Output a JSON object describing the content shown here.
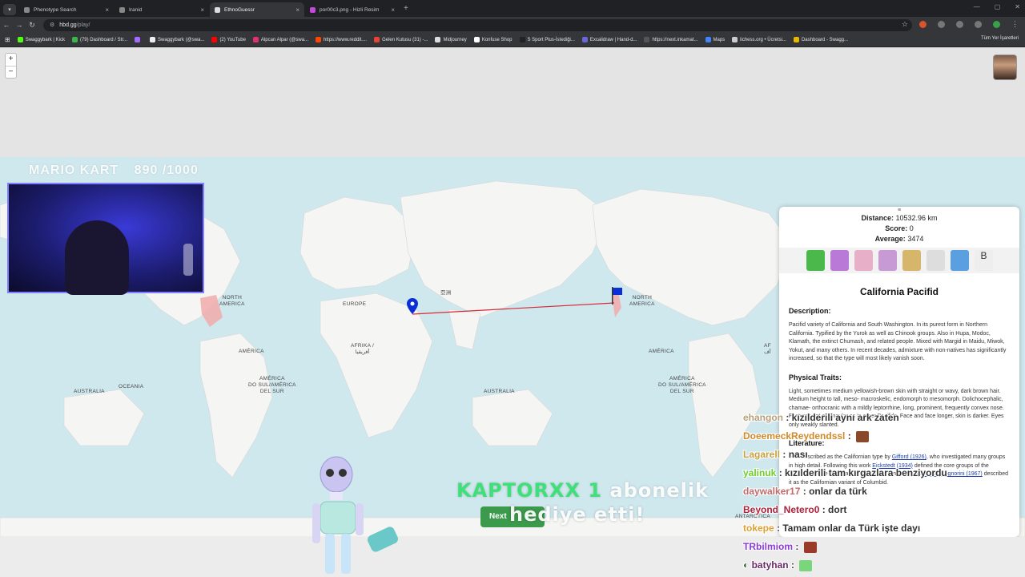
{
  "browser": {
    "tabs": [
      {
        "label": "Phenotype Search",
        "active": false
      },
      {
        "label": "Iranid",
        "active": false
      },
      {
        "label": "EthnoGuessr",
        "active": true
      },
      {
        "label": "por00c3.png - Hizli Resim",
        "active": false
      }
    ],
    "new_tab": "+",
    "url_host": "hbd.gg",
    "url_path": "/play/",
    "bookmarks": [
      {
        "label": "Swaggybark | Kick",
        "color": "#53fc18"
      },
      {
        "label": "(79) Dashboard / Str...",
        "color": "#39b54a"
      },
      {
        "label": "",
        "color": "#a36bff"
      },
      {
        "label": "Swaggybark (@swa...",
        "color": "#eeeeee"
      },
      {
        "label": "(2) YouTube",
        "color": "#ff0000"
      },
      {
        "label": "Alpcan Alpar (@swa...",
        "color": "#e1306c"
      },
      {
        "label": "https://www.reddit....",
        "color": "#ff4500"
      },
      {
        "label": "Gelen Kutusu (31) -...",
        "color": "#ea4335"
      },
      {
        "label": "Midjourney",
        "color": "#dddddd"
      },
      {
        "label": "Konfuse Shop",
        "color": "#ffffff"
      },
      {
        "label": "S Sport Plus-İstediği...",
        "color": "#222222"
      },
      {
        "label": "Excalidraw | Hand-d...",
        "color": "#6965db"
      },
      {
        "label": "https://next.inkamat...",
        "color": "#555555"
      },
      {
        "label": "Maps",
        "color": "#4285f4"
      },
      {
        "label": "lichess.org • Ücretsi...",
        "color": "#cccccc"
      },
      {
        "label": "Dashboard - Swagg...",
        "color": "#e6b800"
      }
    ],
    "bookmarks_all": "Tüm Yer İşaretleri"
  },
  "map": {
    "zoom_in": "+",
    "zoom_out": "−",
    "labels": {
      "na1": "NORTH\nAMERICA",
      "sa1": "AMÉRICA",
      "europe": "EUROPE",
      "africa": "AFRIKA /\nأفريقيا",
      "asia_jp": "亞洲",
      "australia1": "AUSTRALIA",
      "oceania": "OCEANIA",
      "sa2": "AMÉRICA\nDO SUL/AMÉRICA\nDEL SUR",
      "australia2": "AUSTRALIA",
      "na2": "NORTH\nAMERICA",
      "sa3": "AMÉRICA",
      "sa4": "AMÉRICA\nDO SUL/AMÉRICA\nDEL SUR",
      "antarctica": "ANTARCTICA",
      "africa2": "AF\nأف"
    },
    "guess_color": "#0a2fd6",
    "answer_flag_color": "#0a2fd6",
    "line_color": "#d62b3a"
  },
  "stream_overlay": {
    "title": "MARIO KART",
    "progress": "890 /1000"
  },
  "result": {
    "handle": "≡",
    "distance_label": "Distance:",
    "distance_value": "10532.96 km",
    "score_label": "Score:",
    "score_value": "0",
    "average_label": "Average:",
    "average_value": "3474",
    "name": "California Pacifid",
    "description_heading": "Description:",
    "description": "Pacifid variety of California and South Washington. In its purest form in Northern California. Typified by the Yurok as well as Chinook groups. Also in Hupa, Modoc, Klamath, the extinct Chumash, and related people. Mixed with Margid in Maidu, Miwok, Yokut, and many others. In recent decades, admixture with non-natives has significantly increased, so that the type will most likely vanish soon.",
    "traits_heading": "Physical Traits:",
    "traits": "Light, sometimes medium yellowish-brown skin with straight or wavy, dark brown hair. Medium height to tall, meso- macroskelic, endomorph to mesomorph. Dolichocephalic, chamae- orthocranic with a mildly leptorrhine, long, prominent, frequently convex nose. Features not as angular as in other Pacifids. Face and face longer, skin is darker. Eyes only weakly slanted.",
    "literature_heading": "Literature:",
    "literature_a": "First described as the Californian type by ",
    "literature_link1": "Gifford (1926)",
    "literature_b": ", who investigated many groups in high detail. Following this work ",
    "literature_link2": "Eickstedt (1934)",
    "literature_c": " defined the core groups of the Californian type as a Pacifid subvariety. Similarly, ",
    "literature_link3": "Biasutti and Signorini (1967)",
    "literature_d": " described it as the Californian variant of Columbid."
  },
  "chat": [
    {
      "user": "ehangon",
      "sep": " : ",
      "msg": "kızılderili aynı ark zaten",
      "color": "#b8a07a"
    },
    {
      "user": "DoeemeckReydendssl",
      "sep": " : ",
      "msg": "",
      "color": "#d08a2a",
      "emote": "#8a4a2a"
    },
    {
      "user": "Lagarell",
      "sep": " : ",
      "msg": "nası",
      "color": "#c7a040"
    },
    {
      "user": "yalinuk",
      "sep": " : ",
      "msg": "kızılderili tam kırgazlara benziyordu",
      "color": "#6ccf2a"
    },
    {
      "user": "daywalker17",
      "sep": " : ",
      "msg": "onlar da türk",
      "color": "#c06a6a"
    },
    {
      "user": "Beyond_Netero0",
      "sep": " : ",
      "msg": "dort",
      "color": "#b0203a"
    },
    {
      "user": "tokepe",
      "sep": " : ",
      "msg": "Tamam onlar da Türk işte dayı",
      "color": "#e0a030"
    },
    {
      "user": "TRbilmiom",
      "sep": " : ",
      "msg": "",
      "color": "#8a3ad6",
      "emote": "#9a3a2a"
    },
    {
      "user": "batyhan",
      "sep": " : ",
      "msg": "",
      "color": "#6a2a6a",
      "emote": "#7ad67a"
    }
  ],
  "alert": {
    "user": "KAPTORXX 1",
    "line1_rest": "abonelik",
    "line2": "hediye etti!",
    "user_color": "#3fe07a"
  },
  "next_button": "Next"
}
